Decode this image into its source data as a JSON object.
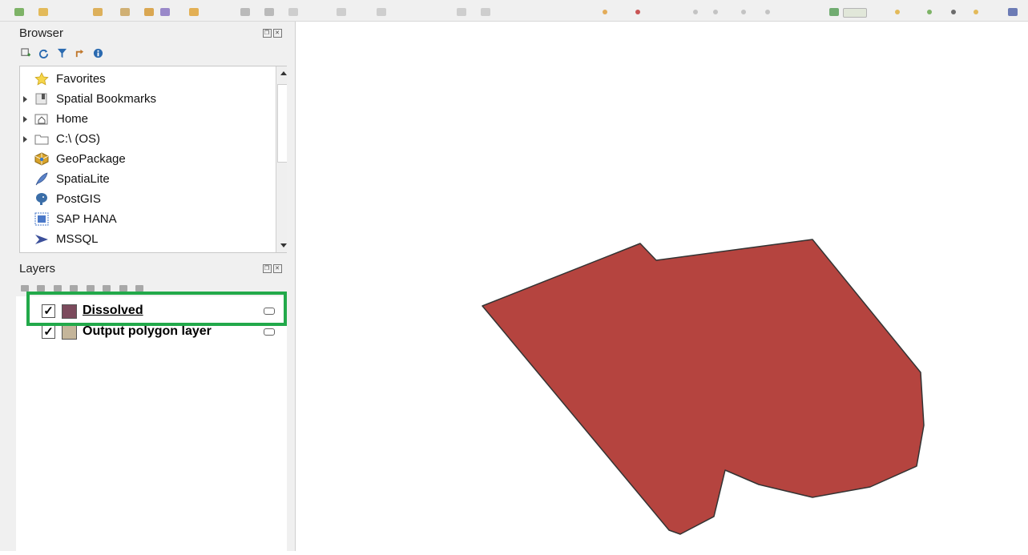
{
  "browser": {
    "title": "Browser",
    "toolbar_icons": [
      "add-layer-icon",
      "refresh-icon",
      "filter-icon",
      "collapse-all-icon",
      "info-icon"
    ],
    "items": [
      {
        "label": "Favorites",
        "icon": "star-icon",
        "expandable": false
      },
      {
        "label": "Spatial Bookmarks",
        "icon": "bookmark-icon",
        "expandable": true
      },
      {
        "label": "Home",
        "icon": "home-folder-icon",
        "expandable": true
      },
      {
        "label": "C:\\ (OS)",
        "icon": "folder-icon",
        "expandable": true
      },
      {
        "label": "GeoPackage",
        "icon": "geopackage-icon",
        "expandable": false
      },
      {
        "label": "SpatiaLite",
        "icon": "spatialite-feather-icon",
        "expandable": false
      },
      {
        "label": "PostGIS",
        "icon": "postgis-elephant-icon",
        "expandable": false
      },
      {
        "label": "SAP HANA",
        "icon": "sap-hana-icon",
        "expandable": false
      },
      {
        "label": "MSSQL",
        "icon": "mssql-icon",
        "expandable": false
      }
    ]
  },
  "layers": {
    "title": "Layers",
    "items": [
      {
        "label": "Dissolved",
        "checked": true,
        "selected": true,
        "swatch_color": "#7b4a5c"
      },
      {
        "label": "Output polygon layer",
        "checked": true,
        "selected": false,
        "swatch_color": "#c4b59a"
      }
    ]
  },
  "map": {
    "polygon_fill": "#b5443f",
    "polygon_stroke": "#333333"
  },
  "colors": {
    "highlight": "#22a94a",
    "panel_bg": "#f0f0f0"
  }
}
